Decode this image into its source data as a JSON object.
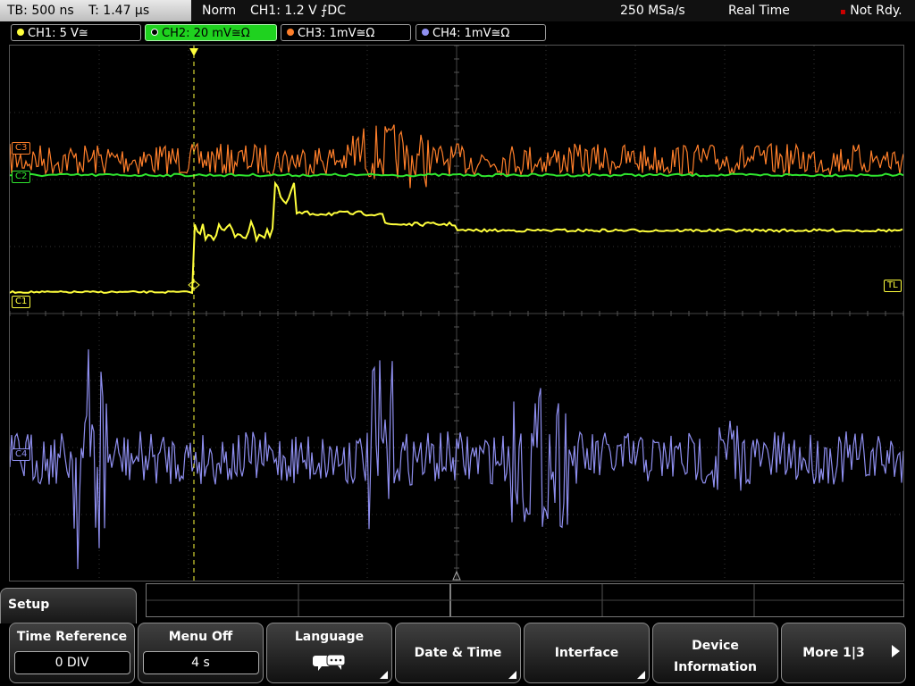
{
  "status_bar": {
    "timebase": "TB: 500 ns",
    "trigger_time": "T: 1.47 µs",
    "trigger_mode": "Norm",
    "trigger_source": "CH1: 1.2 V ⨍DC",
    "sample_rate": "250 MSa/s",
    "acq_mode": "Real Time",
    "state": "Not Rdy."
  },
  "channels": [
    {
      "label": "CH1: 5 V≅",
      "color": "#ffff3c",
      "active": false
    },
    {
      "label": "CH2: 20 mV≅Ω",
      "color": "#2fe62f",
      "active": true
    },
    {
      "label": "CH3: 1mV≅Ω",
      "color": "#ff7f2a",
      "active": false
    },
    {
      "label": "CH4: 1mV≅Ω",
      "color": "#8f8ff0",
      "active": false
    }
  ],
  "markers": {
    "c1": "C1",
    "c2": "C2",
    "c3": "C3",
    "c4": "C4",
    "trigger_level": "TL",
    "trigger_pos": "T"
  },
  "menu": {
    "title": "Setup",
    "softkeys": [
      {
        "label": "Time Reference",
        "value": "0 DIV"
      },
      {
        "label": "Menu Off",
        "value": "4 s"
      },
      {
        "label": "Language",
        "icon": "speech-bubbles-icon"
      },
      {
        "label": "Date & Time"
      },
      {
        "label": "Interface"
      },
      {
        "label": "Device",
        "label2": "Information"
      },
      {
        "label": "More 1|3"
      }
    ]
  }
}
